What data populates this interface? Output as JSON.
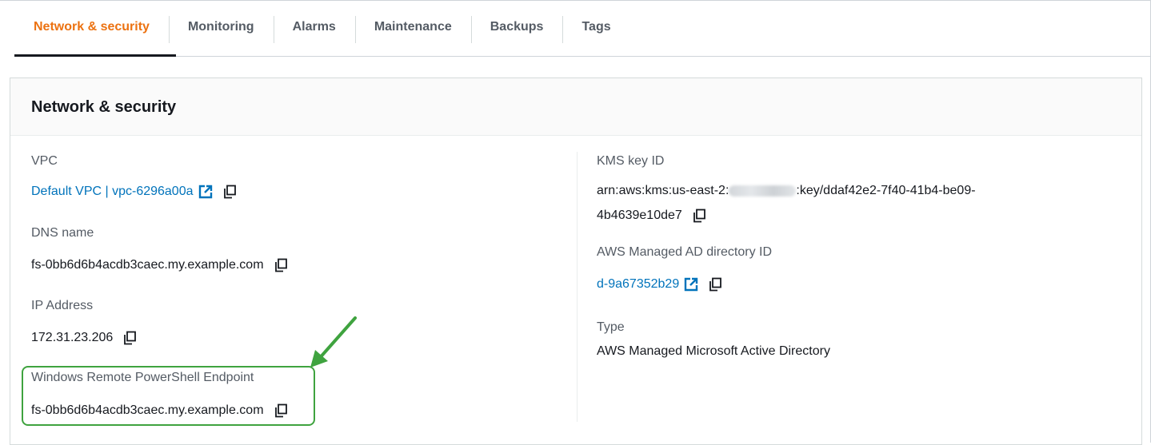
{
  "tabs": [
    {
      "label": "Network & security",
      "active": true
    },
    {
      "label": "Monitoring",
      "active": false
    },
    {
      "label": "Alarms",
      "active": false
    },
    {
      "label": "Maintenance",
      "active": false
    },
    {
      "label": "Backups",
      "active": false
    },
    {
      "label": "Tags",
      "active": false
    }
  ],
  "panel": {
    "title": "Network & security",
    "left": {
      "vpc": {
        "label": "VPC",
        "value": "Default VPC | vpc-6296a00a"
      },
      "dns": {
        "label": "DNS name",
        "value": "fs-0bb6d6b4acdb3caec.my.example.com"
      },
      "ip": {
        "label": "IP Address",
        "value": "172.31.23.206"
      },
      "powershell": {
        "label": "Windows Remote PowerShell Endpoint",
        "value": "fs-0bb6d6b4acdb3caec.my.example.com"
      }
    },
    "right": {
      "kms": {
        "label": "KMS key ID",
        "value_prefix": "arn:aws:kms:us-east-2:",
        "value_suffix": ":key/ddaf42e2-7f40-41b4-be09-",
        "value_line2": "4b4639e10de7"
      },
      "ad": {
        "label": "AWS Managed AD directory ID",
        "value": "d-9a67352b29"
      },
      "type": {
        "label": "Type",
        "value": "AWS Managed Microsoft Active Directory"
      }
    }
  },
  "icons": {
    "external_link": "external-link-icon",
    "copy": "copy-icon",
    "annotation_arrow": "annotation-arrow-icon"
  },
  "colors": {
    "active_tab": "#ec7211",
    "link": "#0073bb",
    "callout_green": "#3fa33f"
  }
}
